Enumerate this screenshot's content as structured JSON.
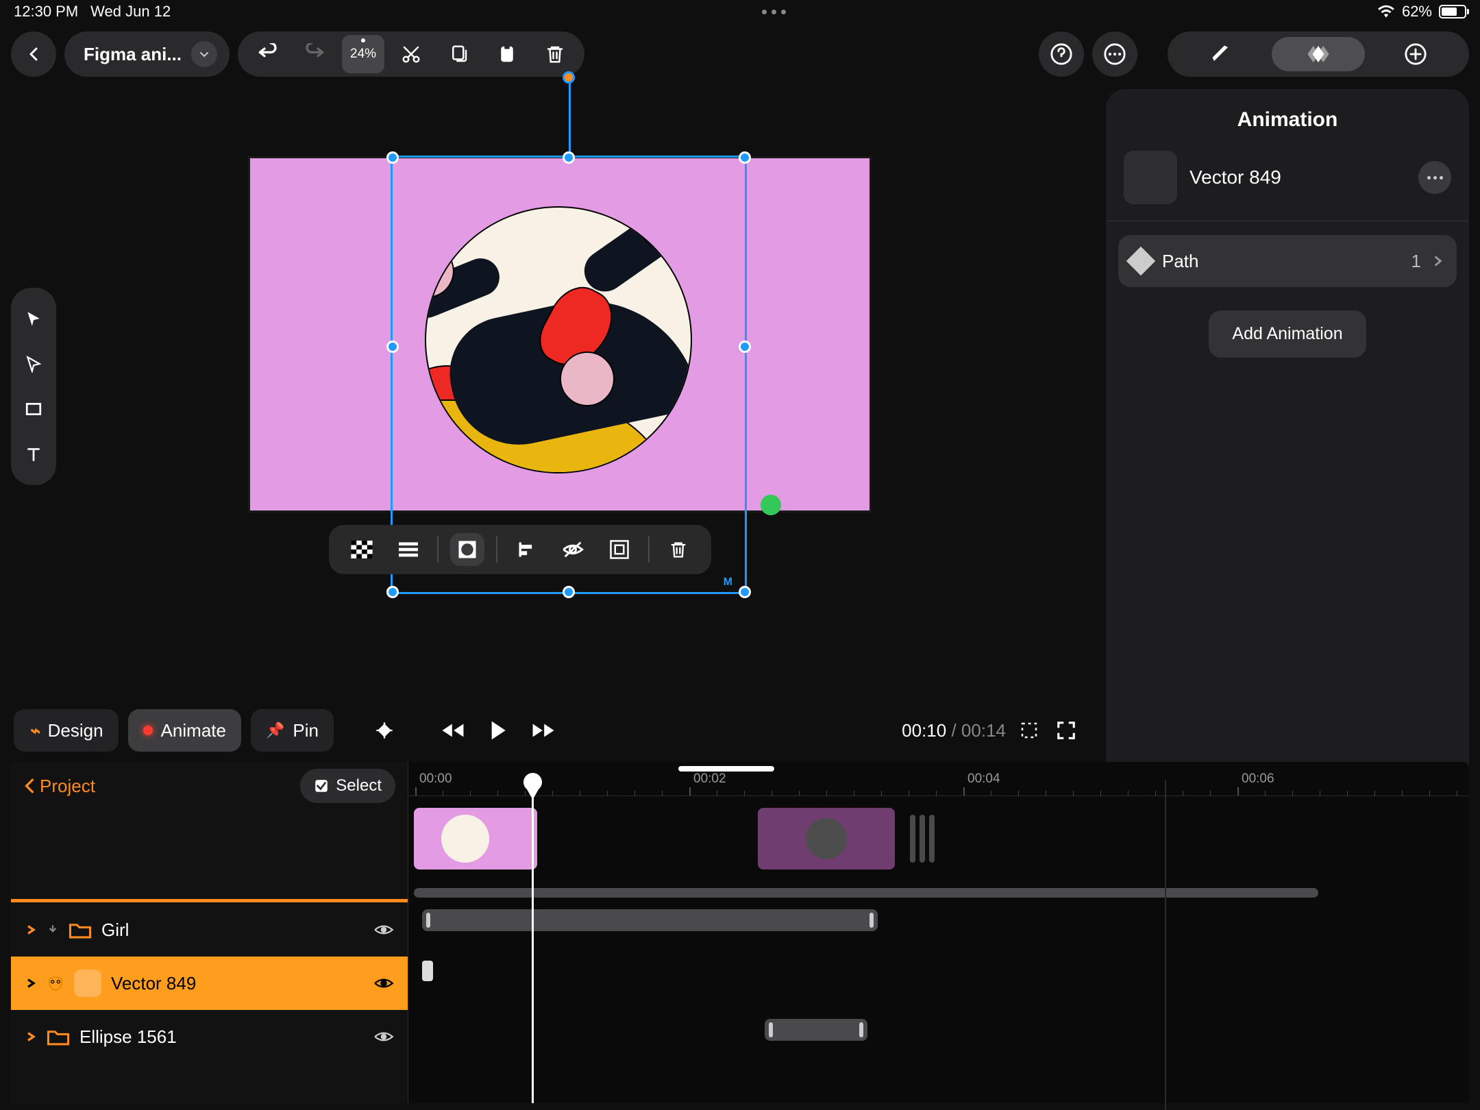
{
  "status": {
    "time": "12:30 PM",
    "date": "Wed Jun 12",
    "battery_pct": "62%"
  },
  "project": {
    "name": "Figma ani..."
  },
  "toolbar": {
    "zoom": "24%"
  },
  "canvas": {
    "selected_letter": "M"
  },
  "mode": {
    "design": "Design",
    "animate": "Animate",
    "pin": "Pin"
  },
  "playback": {
    "current": "00:10",
    "total": "00:14"
  },
  "timeline_nav": {
    "back": "Project",
    "select": "Select"
  },
  "layers": [
    {
      "name": "Girl",
      "type": "folder",
      "selected": false
    },
    {
      "name": "Vector 849",
      "type": "vector",
      "selected": true
    },
    {
      "name": "Ellipse 1561",
      "type": "folder",
      "selected": false
    }
  ],
  "ruler": {
    "ticks": [
      "00:00",
      "00:02",
      "00:04",
      "00:06"
    ]
  },
  "panel": {
    "title": "Animation",
    "object_name": "Vector 849",
    "property": {
      "label": "Path",
      "count": "1"
    },
    "add_label": "Add Animation"
  }
}
